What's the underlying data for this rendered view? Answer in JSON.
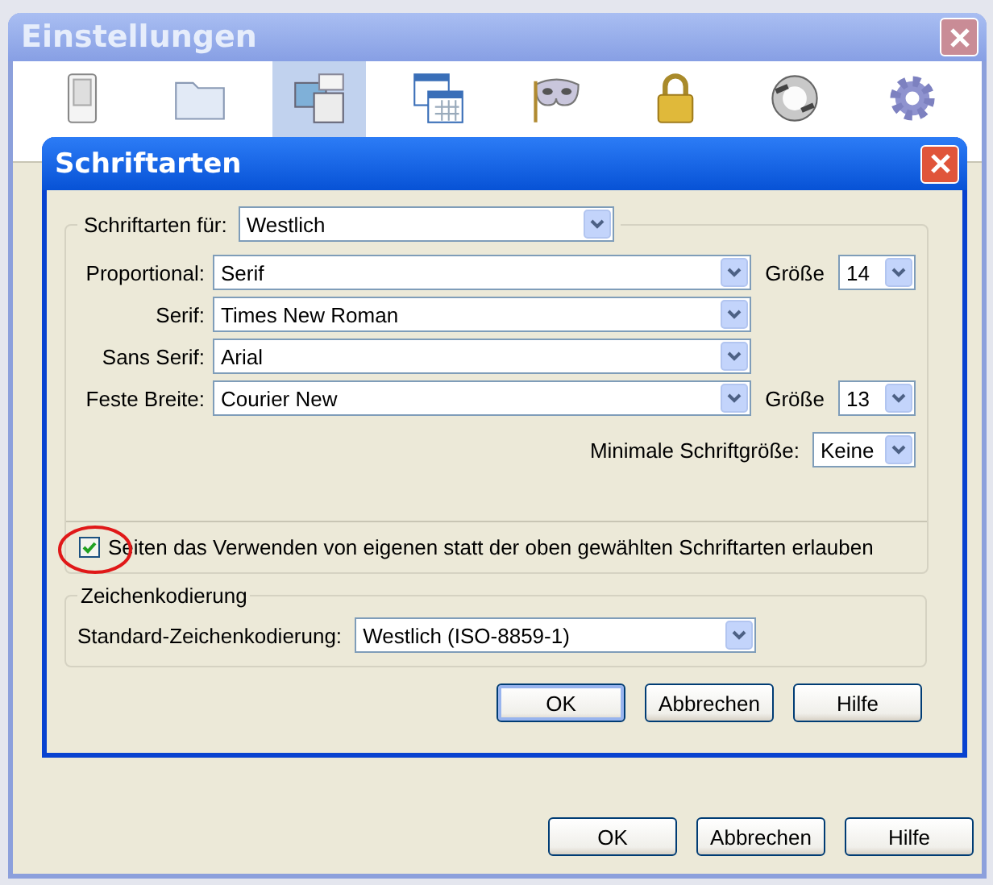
{
  "window": {
    "title": "Einstellungen"
  },
  "toolbar": [
    {
      "kind": "switch",
      "selected": false
    },
    {
      "kind": "folder",
      "selected": false
    },
    {
      "kind": "content",
      "selected": true
    },
    {
      "kind": "calendar",
      "selected": false
    },
    {
      "kind": "mask",
      "selected": false
    },
    {
      "kind": "lock",
      "selected": false
    },
    {
      "kind": "sync",
      "selected": false
    },
    {
      "kind": "gear",
      "selected": false
    }
  ],
  "dialog": {
    "title": "Schriftarten",
    "fonts_for": {
      "label": "Schriftarten für:",
      "value": "Westlich"
    },
    "rows": [
      {
        "label": "Proportional:",
        "value": "Serif",
        "size_label": "Größe",
        "size": "14"
      },
      {
        "label": "Serif:",
        "value": "Times New Roman"
      },
      {
        "label": "Sans Serif:",
        "value": "Arial"
      },
      {
        "label": "Feste Breite:",
        "value": "Courier New",
        "size_label": "Größe",
        "size": "13"
      }
    ],
    "minimum": {
      "label": "Minimale Schriftgröße:",
      "value": "Keine"
    },
    "allow_pages": {
      "label": "Seiten das Verwenden von eigenen statt der oben gewählten Schriftarten erlauben",
      "checked": true,
      "circled": true
    },
    "encoding": {
      "title": "Zeichenkodierung",
      "label": "Standard-Zeichenkodierung:",
      "value": "Westlich (ISO-8859-1)"
    },
    "buttons": [
      {
        "label": "OK",
        "default": true
      },
      {
        "label": "Abbrechen",
        "default": false
      },
      {
        "label": "Hilfe",
        "default": false
      }
    ]
  },
  "buttons": [
    {
      "label": "OK",
      "default": false
    },
    {
      "label": "Abbrechen",
      "default": false
    },
    {
      "label": "Hilfe",
      "default": false
    }
  ]
}
